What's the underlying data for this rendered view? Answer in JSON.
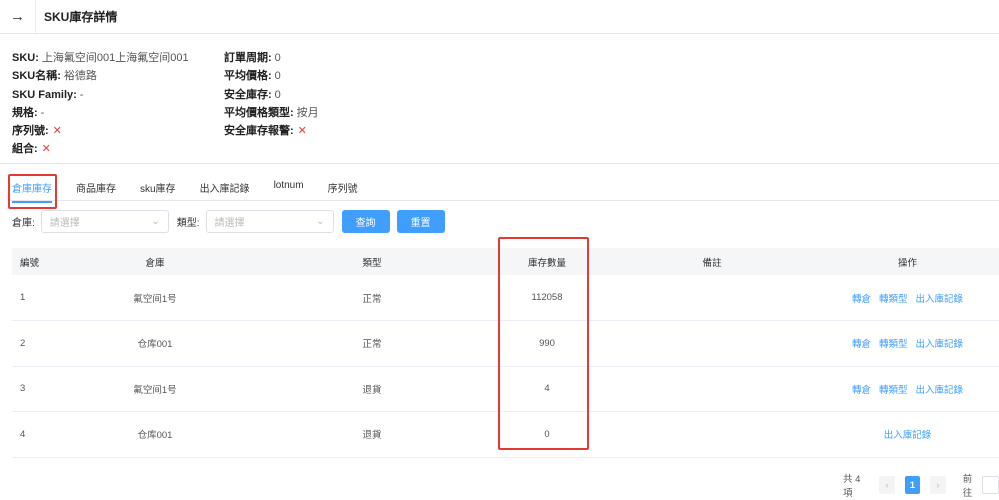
{
  "header": {
    "back_icon": "arrow-right-icon",
    "title": "SKU庫存詳情"
  },
  "info_left": [
    {
      "label": "SKU:",
      "value": "上海氟空间001上海氟空间001"
    },
    {
      "label": "SKU名稱:",
      "value": "裕德路"
    },
    {
      "label": "SKU Family:",
      "value": "-"
    },
    {
      "label": "規格:",
      "value": "-"
    },
    {
      "label": "序列號:",
      "value": "✕"
    },
    {
      "label": "組合:",
      "value": "✕"
    }
  ],
  "info_right": [
    {
      "label": "訂單周期:",
      "value": "0"
    },
    {
      "label": "平均價格:",
      "value": "0"
    },
    {
      "label": "安全庫存:",
      "value": "0"
    },
    {
      "label": "平均價格類型:",
      "value": "按月"
    },
    {
      "label": "安全庫存報警:",
      "value": "✕"
    }
  ],
  "tabs": [
    "倉庫庫存",
    "商品庫存",
    "sku庫存",
    "出入庫記錄",
    "lotnum",
    "序列號"
  ],
  "filters": {
    "warehouse_label": "倉庫:",
    "warehouse_placeholder": "請選擇",
    "type_label": "類型:",
    "type_placeholder": "請選擇",
    "query": "查詢",
    "reset": "重置"
  },
  "table": {
    "headers": [
      "編號",
      "倉庫",
      "類型",
      "庫存數量",
      "備註",
      "操作"
    ],
    "rows": [
      {
        "id": "1",
        "warehouse": "氟空间1号",
        "type": "正常",
        "qty": "112058",
        "note": "",
        "actions": [
          "轉倉",
          "轉類型",
          "出入庫記錄"
        ]
      },
      {
        "id": "2",
        "warehouse": "仓库001",
        "type": "正常",
        "qty": "990",
        "note": "",
        "actions": [
          "轉倉",
          "轉類型",
          "出入庫記錄"
        ]
      },
      {
        "id": "3",
        "warehouse": "氟空间1号",
        "type": "退貨",
        "qty": "4",
        "note": "",
        "actions": [
          "轉倉",
          "轉類型",
          "出入庫記錄"
        ]
      },
      {
        "id": "4",
        "warehouse": "仓库001",
        "type": "退貨",
        "qty": "0",
        "note": "",
        "actions": [
          "出入庫記錄"
        ]
      }
    ]
  },
  "pagination": {
    "total": "共 4 項",
    "prev": "‹",
    "page": "1",
    "next": "›",
    "goto": "前往"
  },
  "colors": {
    "accent": "#409eff",
    "highlight": "#e53935"
  }
}
